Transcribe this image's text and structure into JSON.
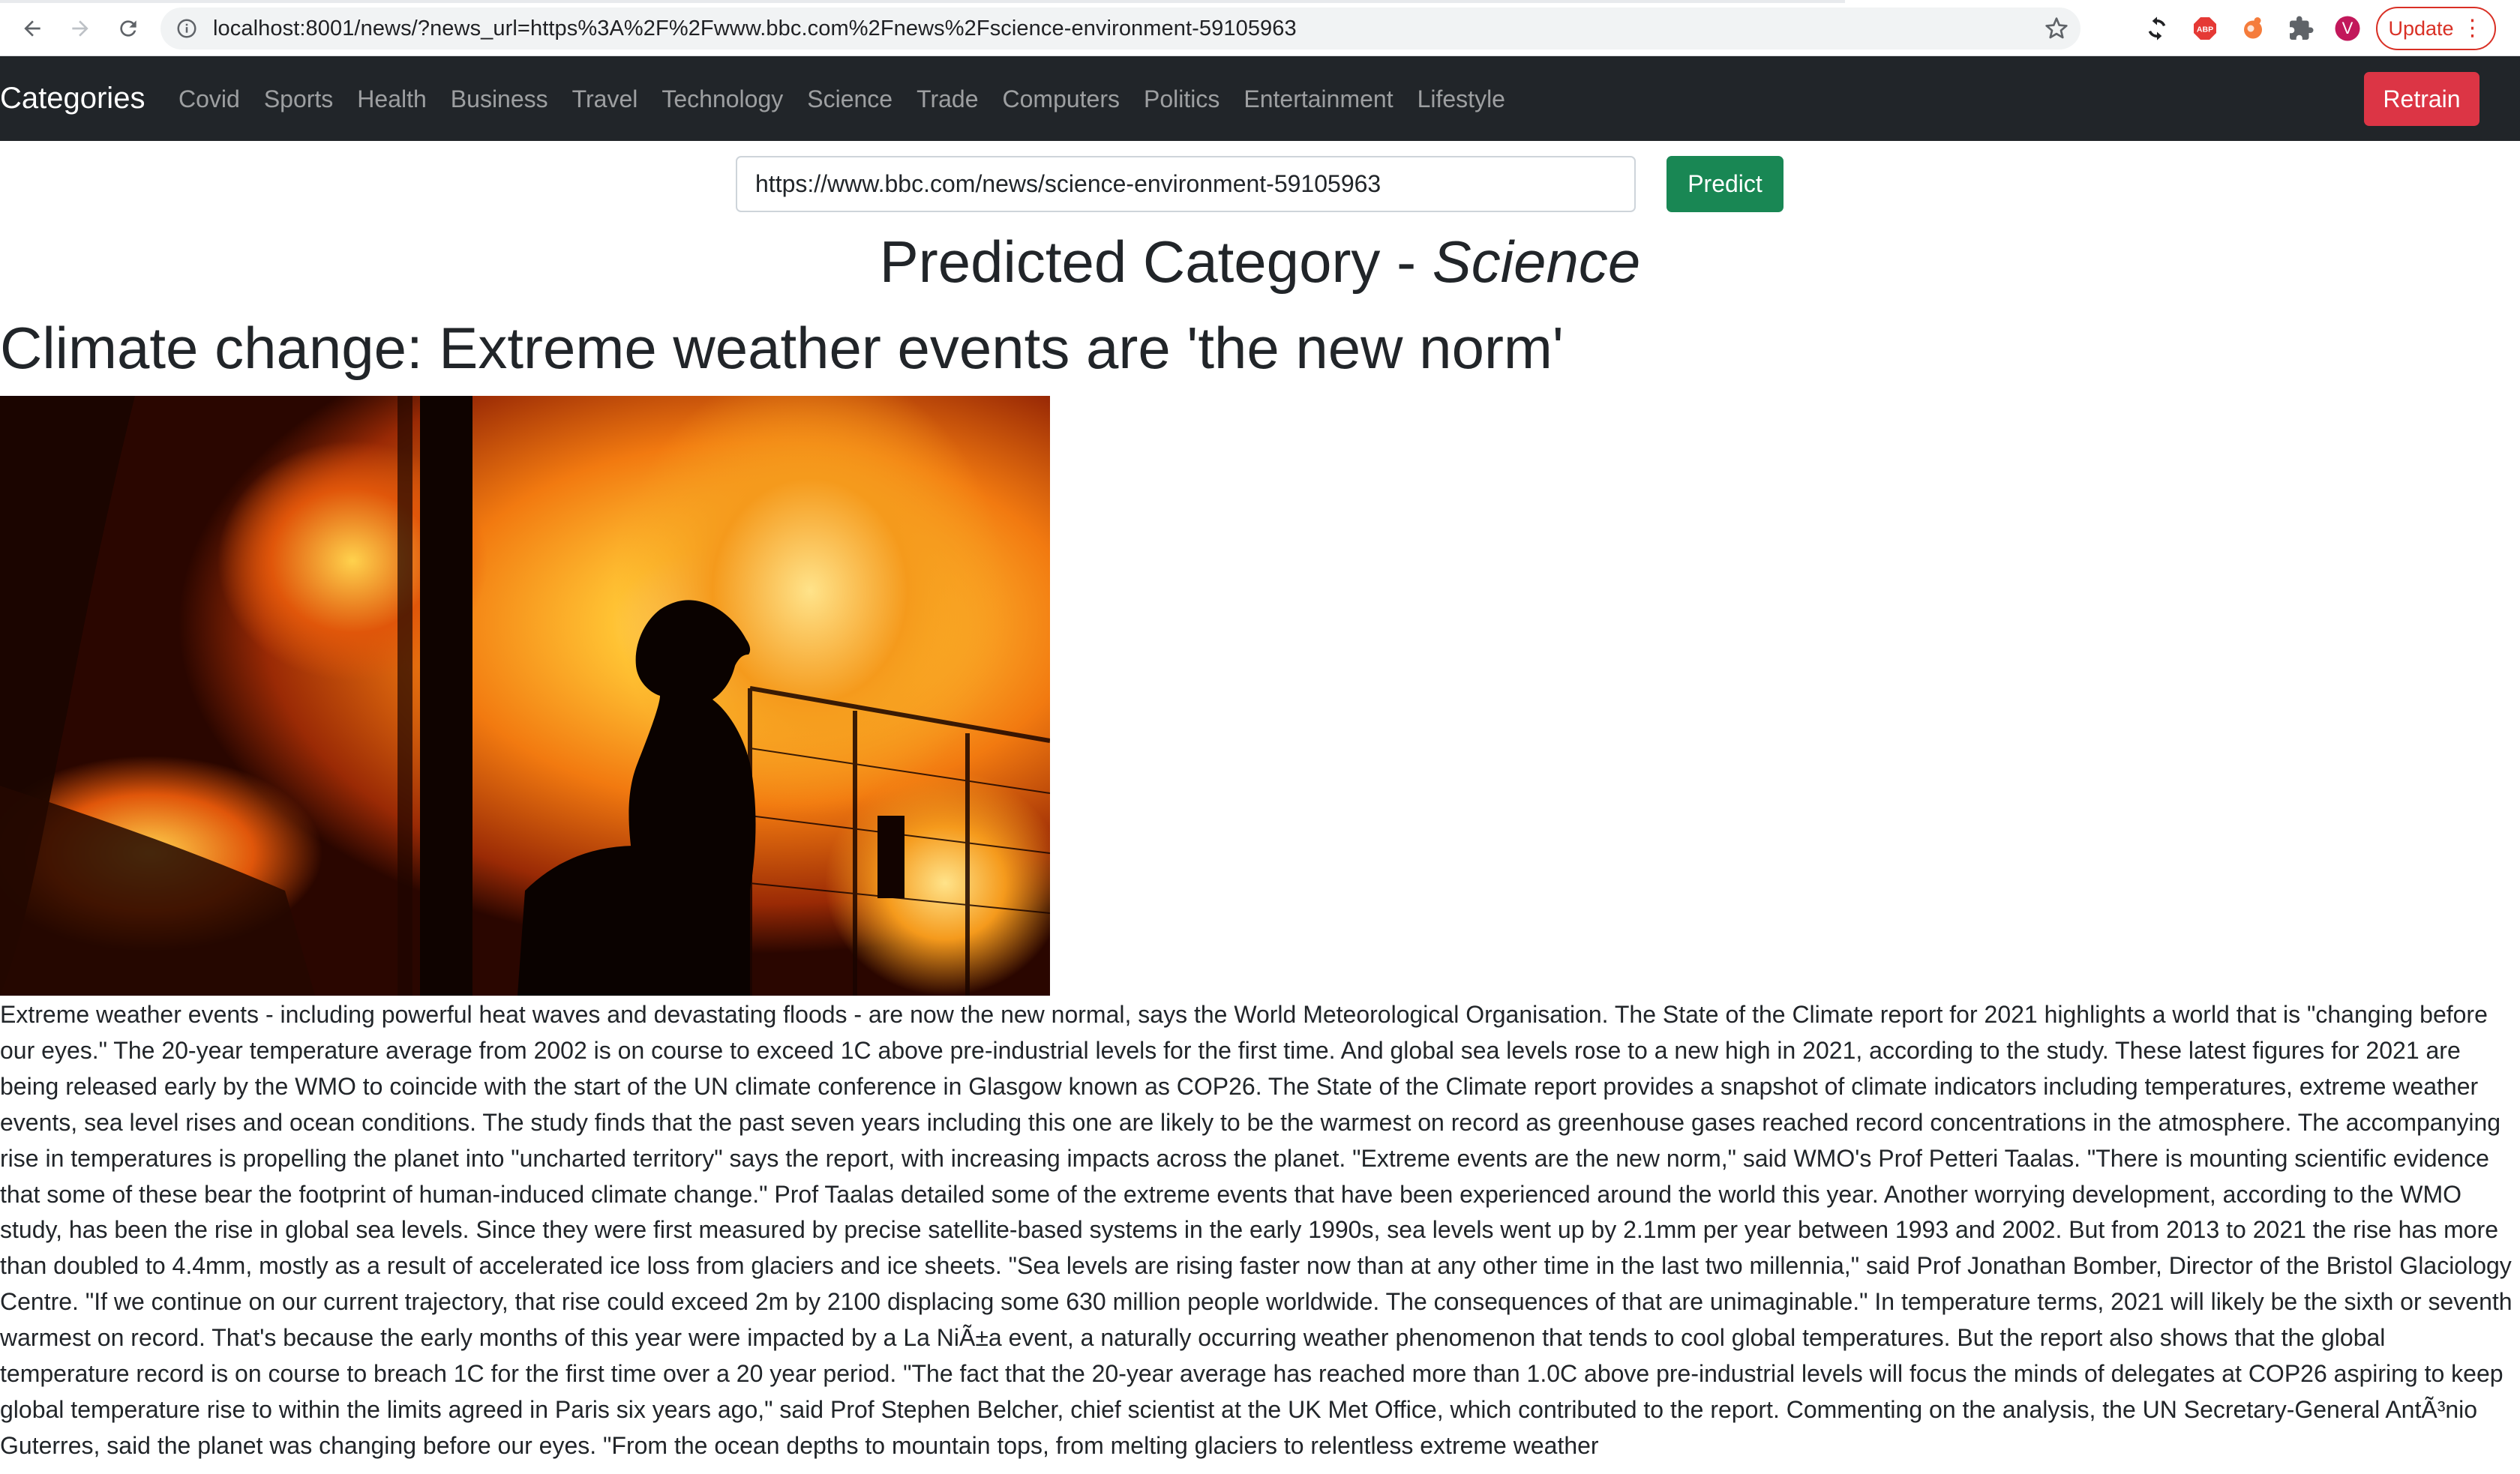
{
  "browser": {
    "url": "localhost:8001/news/?news_url=https%3A%2F%2Fwww.bbc.com%2Fnews%2Fscience-environment-59105963",
    "update_label": "Update",
    "profile_initial": "V",
    "extensions": [
      "sync-icon",
      "adblock-plus-icon",
      "extension-icon",
      "puzzle-icon"
    ]
  },
  "navbar": {
    "brand": "Categories",
    "links": [
      "Covid",
      "Sports",
      "Health",
      "Business",
      "Travel",
      "Technology",
      "Science",
      "Trade",
      "Computers",
      "Politics",
      "Entertainment",
      "Lifestyle"
    ],
    "retrain_label": "Retrain"
  },
  "search": {
    "value": "https://www.bbc.com/news/science-environment-59105963",
    "predict_label": "Predict"
  },
  "result": {
    "prefix": "Predicted Category - ",
    "category": "Science"
  },
  "article": {
    "headline": "Climate change: Extreme weather events are 'the new norm'",
    "body": "Extreme weather events - including powerful heat waves and devastating floods - are now the new normal, says the World Meteorological Organisation. The State of the Climate report for 2021 highlights a world that is \"changing before our eyes.\" The 20-year temperature average from 2002 is on course to exceed 1C above pre-industrial levels for the first time. And global sea levels rose to a new high in 2021, according to the study. These latest figures for 2021 are being released early by the WMO to coincide with the start of the UN climate conference in Glasgow known as COP26. The State of the Climate report provides a snapshot of climate indicators including temperatures, extreme weather events, sea level rises and ocean conditions. The study finds that the past seven years including this one are likely to be the warmest on record as greenhouse gases reached record concentrations in the atmosphere. The accompanying rise in temperatures is propelling the planet into \"uncharted territory\" says the report, with increasing impacts across the planet. \"Extreme events are the new norm,\" said WMO's Prof Petteri Taalas. \"There is mounting scientific evidence that some of these bear the footprint of human-induced climate change.\" Prof Taalas detailed some of the extreme events that have been experienced around the world this year. Another worrying development, according to the WMO study, has been the rise in global sea levels. Since they were first measured by precise satellite-based systems in the early 1990s, sea levels went up by 2.1mm per year between 1993 and 2002. But from 2013 to 2021 the rise has more than doubled to 4.4mm, mostly as a result of accelerated ice loss from glaciers and ice sheets. \"Sea levels are rising faster now than at any other time in the last two millennia,\" said Prof Jonathan Bomber, Director of the Bristol Glaciology Centre. \"If we continue on our current trajectory, that rise could exceed 2m by 2100 displacing some 630 million people worldwide. The consequences of that are unimaginable.\" In temperature terms, 2021 will likely be the sixth or seventh warmest on record. That's because the early months of this year were impacted by a La NiÃ±a event, a naturally occurring weather phenomenon that tends to cool global temperatures. But the report also shows that the global temperature record is on course to breach 1C for the first time over a 20 year period. \"The fact that the 20-year average has reached more than 1.0C above pre-industrial levels will focus the minds of delegates at COP26 aspiring to keep global temperature rise to within the limits agreed in Paris six years ago,\" said Prof Stephen Belcher, chief scientist at the UK Met Office, which contributed to the report. Commenting on the analysis, the UN Secretary-General AntÃ³nio Guterres, said the planet was changing before our eyes. \"From the ocean depths to mountain tops, from melting glaciers to relentless extreme weather"
  },
  "colors": {
    "navbar_bg": "#212529",
    "retrain_bg": "#dc3545",
    "predict_bg": "#198754",
    "text": "#212529"
  }
}
